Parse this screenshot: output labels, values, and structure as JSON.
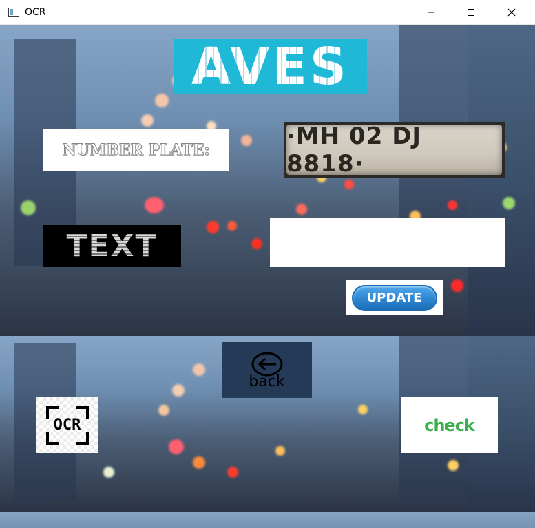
{
  "window": {
    "title": "OCR",
    "controls": [
      "minimize-icon",
      "maximize-icon",
      "close-icon"
    ]
  },
  "banner": {
    "text": "AVES",
    "color": "#1fb8d7"
  },
  "number_plate": {
    "label": "NUMBER PLATE:",
    "plate_text": "·MH 02 DJ 8818·"
  },
  "text_section": {
    "label": "TEXT",
    "output_value": ""
  },
  "buttons": {
    "update": "UPDATE",
    "back": "back",
    "ocr": "OCR",
    "check": "check"
  },
  "colors": {
    "update_blue": "#2d86d2",
    "check_green": "#3dae4f"
  }
}
